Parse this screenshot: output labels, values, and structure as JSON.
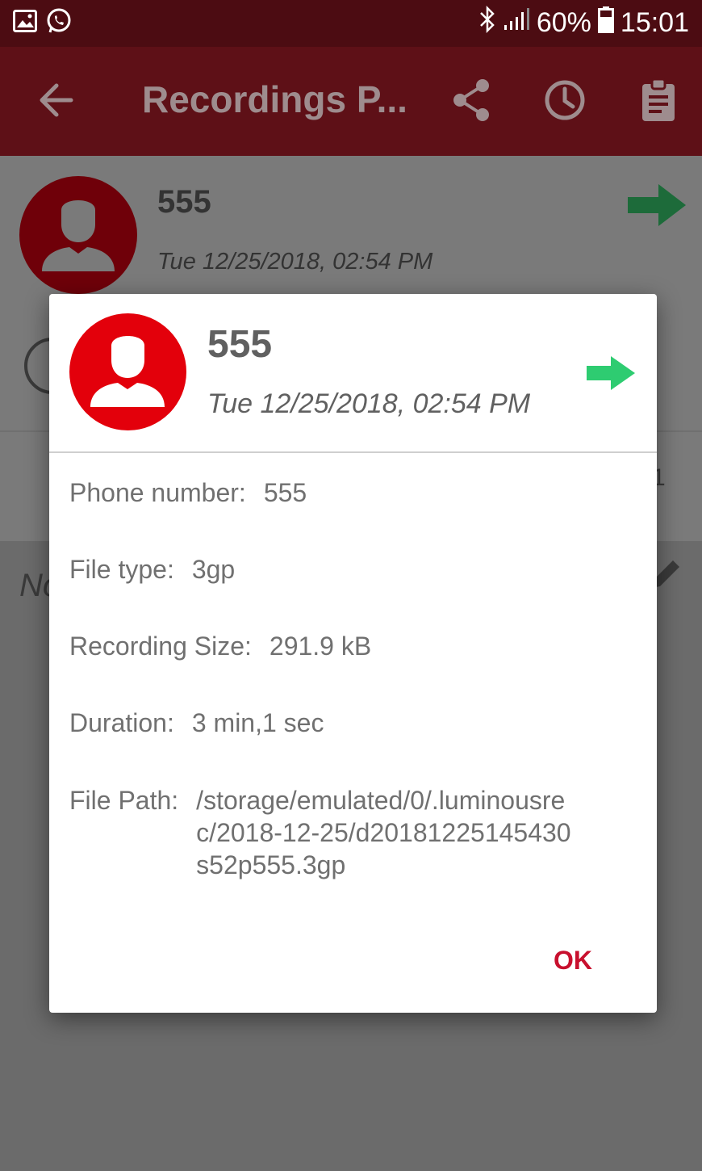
{
  "status_bar": {
    "battery": "60%",
    "time": "15:01",
    "icons": [
      "gallery-icon",
      "whatsapp-icon",
      "bluetooth-icon",
      "signal-icon",
      "battery-icon"
    ]
  },
  "app_bar": {
    "title": "Recordings P...",
    "actions": [
      "back-arrow-icon",
      "share-icon",
      "clock-icon",
      "clipboard-icon"
    ]
  },
  "background": {
    "contact_name": "555",
    "date": "Tue 12/25/2018, 02:54 PM",
    "notes_partial": "No",
    "right_partial": "1"
  },
  "dialog": {
    "contact_name": "555",
    "date": "Tue 12/25/2018, 02:54 PM",
    "rows": [
      {
        "label": "Phone number:",
        "value": "555"
      },
      {
        "label": "File type:",
        "value": "3gp"
      },
      {
        "label": "Recording Size:",
        "value": "291.9 kB"
      },
      {
        "label": "Duration:",
        "value": "3 min,1 sec"
      },
      {
        "label": "File Path:",
        "value": "/storage/emulated/0/.luminousrec/2018-12-25/d20181225145430s52p555.3gp"
      }
    ],
    "ok_label": "OK"
  },
  "colors": {
    "status_bar_bg": "#4c0c12",
    "app_bar_bg": "#5e1017",
    "avatar_red": "#e3000b",
    "arrow_green": "#2ecc71",
    "ok_red": "#c8102e"
  }
}
